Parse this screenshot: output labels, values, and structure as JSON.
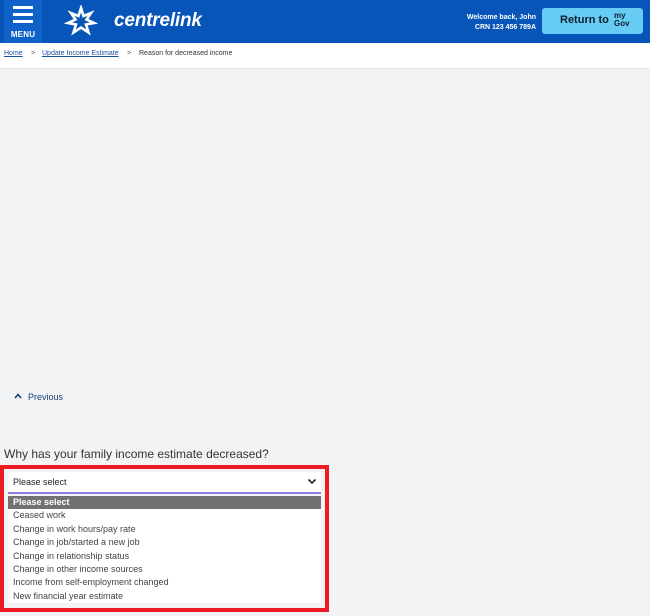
{
  "header": {
    "menu_label": "MENU",
    "brand": "centrelink",
    "welcome_line1": "Welcome back, John",
    "welcome_line2": "CRN 123 456 789A",
    "return_label": "Return to",
    "mygov_line1": "my",
    "mygov_line2": "Gov",
    "colors": {
      "header_bg": "#0755b8",
      "return_bg": "#66ccf3"
    }
  },
  "breadcrumb": {
    "items": [
      "Home",
      "Update Income Estimate",
      "Reason for decreased income"
    ],
    "separator": ">"
  },
  "nav": {
    "previous_label": "Previous"
  },
  "form": {
    "question": "Why has your family income estimate decreased?",
    "select_value": "Please select",
    "options": [
      "Please select",
      "Ceased work",
      "Change in work hours/pay rate",
      "Change in job/started a new job",
      "Change in relationship status",
      "Change in other income sources",
      "Income from self-employment changed",
      "New financial year estimate"
    ]
  }
}
